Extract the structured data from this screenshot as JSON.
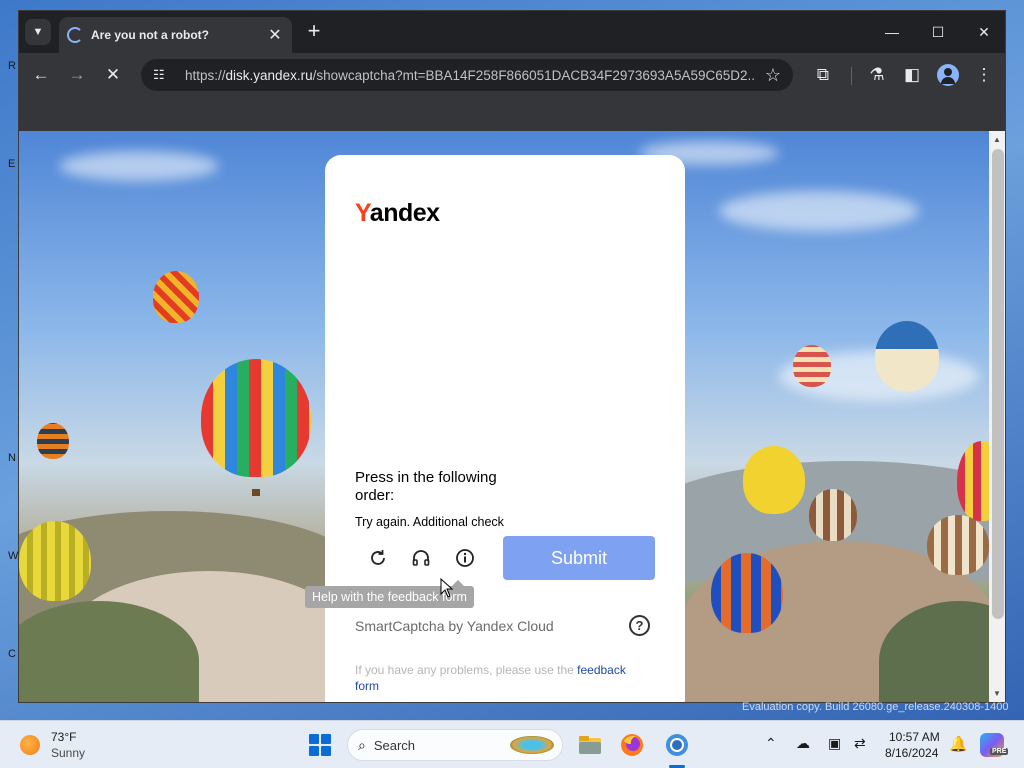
{
  "browser": {
    "tab_title": "Are you not a robot?",
    "url_host": "disk.yandex.ru",
    "url_prefix": "https://",
    "url_path": "/showcaptcha?mt=BBA14F258F866051DACB34F2973693A5A59C65D2..."
  },
  "captcha": {
    "logo_first": "Y",
    "logo_rest": "andex",
    "instruction": "Press in the following order:",
    "status": "Try again. Additional check",
    "submit_label": "Submit",
    "tooltip": "Help with the feedback form",
    "brand": "SmartCaptcha by Yandex Cloud",
    "help_symbol": "?",
    "problem_text": "If you have any problems, please use the",
    "feedback_link": "feedback form"
  },
  "desktop": {
    "watermark": "Evaluation copy. Build 26080.ge_release.240308-1400",
    "edge_letters": [
      "R",
      "E",
      "N",
      "W",
      "C"
    ]
  },
  "taskbar": {
    "weather_temp": "73°F",
    "weather_cond": "Sunny",
    "search_label": "Search",
    "time": "10:57 AM",
    "date": "8/16/2024",
    "copilot_badge": "PRE"
  },
  "icons": {
    "tab_dropdown": "chevron-down-icon",
    "back": "arrow-left-icon",
    "forward": "arrow-right-icon",
    "stop": "close-icon",
    "refresh": "refresh-icon",
    "audio": "headphones-icon",
    "info": "info-icon"
  },
  "colors": {
    "submit": "#7ea1f2",
    "yandex_red": "#fc3f1d",
    "link": "#1f4aa8"
  }
}
